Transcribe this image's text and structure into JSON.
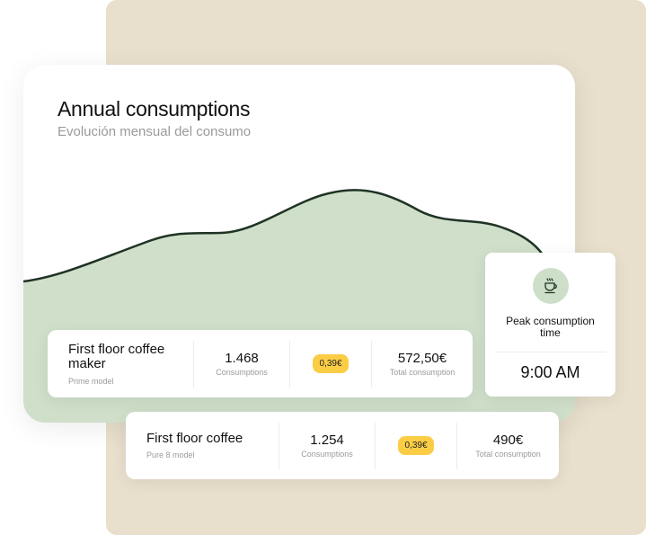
{
  "header": {
    "title": "Annual consumptions",
    "subtitle": "Evolución mensual del consumo"
  },
  "colors": {
    "background_panel": "#e8dfcc",
    "chart_fill": "#cfdfca",
    "chart_line": "#1f3324",
    "price_badge": "#fbcd45",
    "icon_circle": "#cedfc9"
  },
  "devices": [
    {
      "name": "First floor coffee maker",
      "model": "Prime model",
      "consumptions_value": "1.468",
      "consumptions_label": "Consumptions",
      "price": "0,39€",
      "total_value": "572,50€",
      "total_label": "Total consumption"
    },
    {
      "name": "First floor coffee",
      "model": "Pure 8 model",
      "consumptions_value": "1.254",
      "consumptions_label": "Consumptions",
      "price": "0,39€",
      "total_value": "490€",
      "total_label": "Total consumption"
    }
  ],
  "peak": {
    "icon": "coffee-cup-icon",
    "label": "Peak consumption time",
    "time": "9:00 AM"
  }
}
